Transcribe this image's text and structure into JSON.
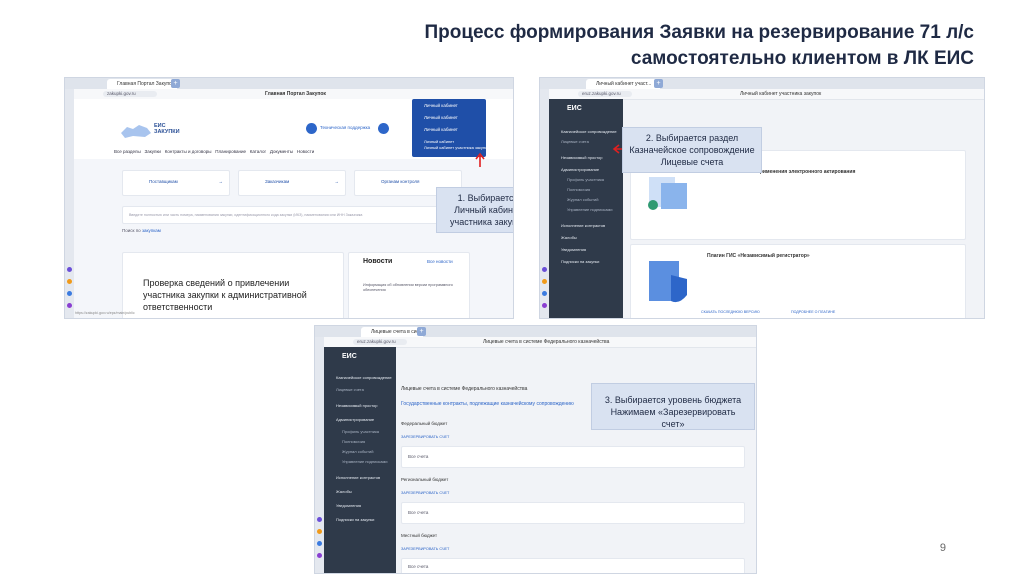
{
  "title": {
    "line1": "Процесс формирования Заявки на резервирование 71 л/с",
    "line2": "самостоятельно клиентом в ЛК ЕИС"
  },
  "callouts": {
    "c1": [
      "1. Выбирается",
      "Личный кабинет",
      "участника закупок"
    ],
    "c2": [
      "2. Выбирается раздел",
      "Казначейское сопровождение",
      "Лицевые счета"
    ],
    "c3": [
      "3. Выбирается уровень бюджета",
      "Нажимаем «Зарезервировать счет»"
    ]
  },
  "page_number": "9",
  "shot1": {
    "tab": "Главная Портал Закупок",
    "url": "zakupki.gov.ru",
    "page_title": "Главная Портал Закупок",
    "logo": [
      "ЕИС",
      "ЗАКУПКИ"
    ],
    "tech_support": "Техническая поддержка",
    "menu": [
      "Личный кабинет",
      "Личный кабинет",
      "Личный кабинет",
      "Личный кабинет",
      "Личный кабинет участника закупок"
    ],
    "nav": [
      "Все разделы",
      "Закупки",
      "Контракты и договоры",
      "Планирование",
      "Каталог",
      "Документы",
      "Новости"
    ],
    "tiles": [
      "Поставщикам",
      "Заказчикам",
      "Органам контроля"
    ],
    "search_hint": "Введите полностью или часть номера, наименования закупки, идентификационного кода закупки (ИКЗ), наименования или ИНН Заказчика",
    "search_in": "Поиск по",
    "search_scope": "закупкам",
    "news_heading": "Новости",
    "all_news": "Все новости",
    "news_item": "Информация об обновлении версии программного обеспечения",
    "article": [
      "Проверка сведений о привлечении",
      "участника закупки к административной",
      "ответственности"
    ],
    "status_url": "https://zakupki.gov.ru/epz/main/public"
  },
  "shot2": {
    "tab": "Личный кабинет участ...",
    "url": "eruz.zakupki.gov.ru",
    "page_title": "Личный кабинет участника закупок",
    "brand": "ЕИС",
    "sidebar": [
      "Казначейское сопровождение",
      "Лицевые счета",
      "Независимый простор",
      "Администрирование",
      "Профиль участника",
      "Полномочия",
      "Журнал событий",
      "Управление подписками",
      "Исполнение контрактов",
      "Жалобы",
      "Уведомления",
      "Подписки на закупки"
    ],
    "card1_title": "Об обязательности применения электронного актирования",
    "card2_title": "Плагин ГИС «Независимый регистратор»",
    "download": "СКАЧАТЬ ПОСЛЕДНЮЮ ВЕРСИЮ",
    "more": "ПОДРОБНЕЕ О ПЛАГИНЕ"
  },
  "shot3": {
    "tab": "Лицевые счета в сист...",
    "url": "eruz.zakupki.gov.ru",
    "page_title": "Лицевые счета в системе Федерального казначейства",
    "brand": "ЕИС",
    "sidebar": [
      "Казначейское сопровождение",
      "Лицевые счета",
      "Независимый простор",
      "Администрирование",
      "Профиль участника",
      "Полномочия",
      "Журнал событий",
      "Управление подписками",
      "Исполнение контрактов",
      "Жалобы",
      "Уведомления",
      "Подписки на закупки"
    ],
    "heading": "Лицевые счета в системе Федерального казначейства",
    "subtab": "Государственные контракты, подлежащие казначейскому сопровождению",
    "budgets": [
      {
        "name": "Федеральный бюджет",
        "action": "ЗАРЕЗЕРВИРОВАТЬ СЧЕТ",
        "row": "Все счета"
      },
      {
        "name": "Региональный бюджет",
        "action": "ЗАРЕЗЕРВИРОВАТЬ СЧЕТ",
        "row": "Все счета"
      },
      {
        "name": "Местный бюджет",
        "action": "ЗАРЕЗЕРВИРОВАТЬ СЧЕТ",
        "row": "Все счета"
      }
    ]
  }
}
